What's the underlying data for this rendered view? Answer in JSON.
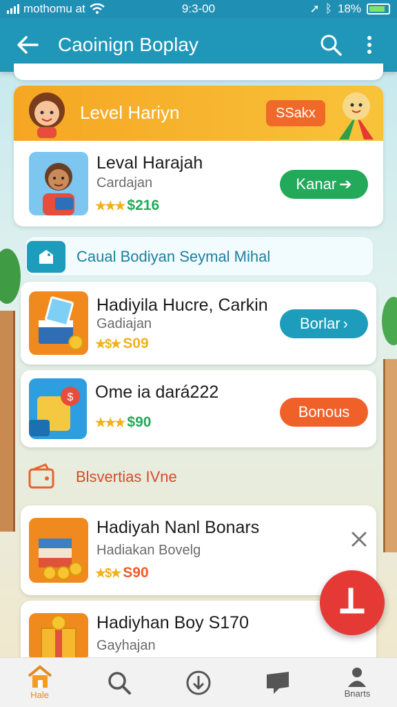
{
  "status": {
    "carrier": "mothomu at",
    "time": "9:3-00",
    "battery": "18%"
  },
  "appbar": {
    "title": "Caoinign Boplay"
  },
  "featured": {
    "header": "Level Hariyn",
    "badge": "SSakx",
    "item": {
      "title": "Leval Harajah",
      "subtitle": "Cardajan",
      "price": "$216",
      "button": "Kanar"
    }
  },
  "section1": {
    "title": "Caual Bodiyan Seymal Mihal"
  },
  "items": [
    {
      "title": "Hadiyila Hucre, Carkin",
      "subtitle": "Gadiajan",
      "price": "S09",
      "button": "Borlar"
    },
    {
      "title": "Ome ia dará222",
      "subtitle": "",
      "price": "$90",
      "button": "Bonous"
    }
  ],
  "section2": {
    "title": "Blsvertias IVne"
  },
  "items2": [
    {
      "title": "Hadiyah Nanl Bonars",
      "subtitle": "Hadiakan Bovelg",
      "price": "S90"
    },
    {
      "title": "Hadiyhan Boy S170",
      "subtitle": "Gayhajan"
    }
  ],
  "tabs": [
    {
      "label": "Hale",
      "icon": "home-icon",
      "active": true
    },
    {
      "label": "",
      "icon": "search-icon"
    },
    {
      "label": "",
      "icon": "download-icon"
    },
    {
      "label": "",
      "icon": "chat-icon"
    },
    {
      "label": "Bnarts",
      "icon": "profile-icon"
    }
  ],
  "colors": {
    "primary": "#2097b8",
    "orange": "#f39c1f",
    "green": "#22a95a",
    "teal": "#1d9dbb",
    "red": "#e53935"
  }
}
